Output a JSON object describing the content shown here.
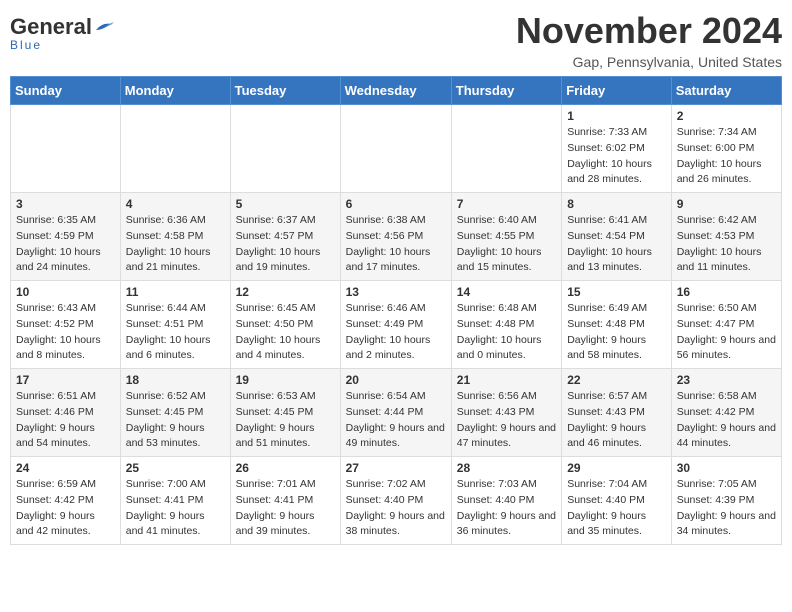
{
  "header": {
    "logo_general": "General",
    "logo_blue": "Blue",
    "month_title": "November 2024",
    "location": "Gap, Pennsylvania, United States"
  },
  "days_of_week": [
    "Sunday",
    "Monday",
    "Tuesday",
    "Wednesday",
    "Thursday",
    "Friday",
    "Saturday"
  ],
  "weeks": [
    [
      {
        "day": "",
        "info": ""
      },
      {
        "day": "",
        "info": ""
      },
      {
        "day": "",
        "info": ""
      },
      {
        "day": "",
        "info": ""
      },
      {
        "day": "",
        "info": ""
      },
      {
        "day": "1",
        "info": "Sunrise: 7:33 AM\nSunset: 6:02 PM\nDaylight: 10 hours and 28 minutes."
      },
      {
        "day": "2",
        "info": "Sunrise: 7:34 AM\nSunset: 6:00 PM\nDaylight: 10 hours and 26 minutes."
      }
    ],
    [
      {
        "day": "3",
        "info": "Sunrise: 6:35 AM\nSunset: 4:59 PM\nDaylight: 10 hours and 24 minutes."
      },
      {
        "day": "4",
        "info": "Sunrise: 6:36 AM\nSunset: 4:58 PM\nDaylight: 10 hours and 21 minutes."
      },
      {
        "day": "5",
        "info": "Sunrise: 6:37 AM\nSunset: 4:57 PM\nDaylight: 10 hours and 19 minutes."
      },
      {
        "day": "6",
        "info": "Sunrise: 6:38 AM\nSunset: 4:56 PM\nDaylight: 10 hours and 17 minutes."
      },
      {
        "day": "7",
        "info": "Sunrise: 6:40 AM\nSunset: 4:55 PM\nDaylight: 10 hours and 15 minutes."
      },
      {
        "day": "8",
        "info": "Sunrise: 6:41 AM\nSunset: 4:54 PM\nDaylight: 10 hours and 13 minutes."
      },
      {
        "day": "9",
        "info": "Sunrise: 6:42 AM\nSunset: 4:53 PM\nDaylight: 10 hours and 11 minutes."
      }
    ],
    [
      {
        "day": "10",
        "info": "Sunrise: 6:43 AM\nSunset: 4:52 PM\nDaylight: 10 hours and 8 minutes."
      },
      {
        "day": "11",
        "info": "Sunrise: 6:44 AM\nSunset: 4:51 PM\nDaylight: 10 hours and 6 minutes."
      },
      {
        "day": "12",
        "info": "Sunrise: 6:45 AM\nSunset: 4:50 PM\nDaylight: 10 hours and 4 minutes."
      },
      {
        "day": "13",
        "info": "Sunrise: 6:46 AM\nSunset: 4:49 PM\nDaylight: 10 hours and 2 minutes."
      },
      {
        "day": "14",
        "info": "Sunrise: 6:48 AM\nSunset: 4:48 PM\nDaylight: 10 hours and 0 minutes."
      },
      {
        "day": "15",
        "info": "Sunrise: 6:49 AM\nSunset: 4:48 PM\nDaylight: 9 hours and 58 minutes."
      },
      {
        "day": "16",
        "info": "Sunrise: 6:50 AM\nSunset: 4:47 PM\nDaylight: 9 hours and 56 minutes."
      }
    ],
    [
      {
        "day": "17",
        "info": "Sunrise: 6:51 AM\nSunset: 4:46 PM\nDaylight: 9 hours and 54 minutes."
      },
      {
        "day": "18",
        "info": "Sunrise: 6:52 AM\nSunset: 4:45 PM\nDaylight: 9 hours and 53 minutes."
      },
      {
        "day": "19",
        "info": "Sunrise: 6:53 AM\nSunset: 4:45 PM\nDaylight: 9 hours and 51 minutes."
      },
      {
        "day": "20",
        "info": "Sunrise: 6:54 AM\nSunset: 4:44 PM\nDaylight: 9 hours and 49 minutes."
      },
      {
        "day": "21",
        "info": "Sunrise: 6:56 AM\nSunset: 4:43 PM\nDaylight: 9 hours and 47 minutes."
      },
      {
        "day": "22",
        "info": "Sunrise: 6:57 AM\nSunset: 4:43 PM\nDaylight: 9 hours and 46 minutes."
      },
      {
        "day": "23",
        "info": "Sunrise: 6:58 AM\nSunset: 4:42 PM\nDaylight: 9 hours and 44 minutes."
      }
    ],
    [
      {
        "day": "24",
        "info": "Sunrise: 6:59 AM\nSunset: 4:42 PM\nDaylight: 9 hours and 42 minutes."
      },
      {
        "day": "25",
        "info": "Sunrise: 7:00 AM\nSunset: 4:41 PM\nDaylight: 9 hours and 41 minutes."
      },
      {
        "day": "26",
        "info": "Sunrise: 7:01 AM\nSunset: 4:41 PM\nDaylight: 9 hours and 39 minutes."
      },
      {
        "day": "27",
        "info": "Sunrise: 7:02 AM\nSunset: 4:40 PM\nDaylight: 9 hours and 38 minutes."
      },
      {
        "day": "28",
        "info": "Sunrise: 7:03 AM\nSunset: 4:40 PM\nDaylight: 9 hours and 36 minutes."
      },
      {
        "day": "29",
        "info": "Sunrise: 7:04 AM\nSunset: 4:40 PM\nDaylight: 9 hours and 35 minutes."
      },
      {
        "day": "30",
        "info": "Sunrise: 7:05 AM\nSunset: 4:39 PM\nDaylight: 9 hours and 34 minutes."
      }
    ]
  ]
}
